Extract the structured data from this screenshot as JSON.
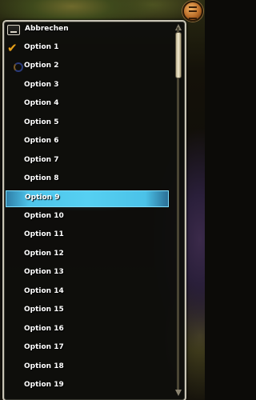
{
  "menu": {
    "cancel_label": "Abbrechen",
    "items": [
      {
        "label": "Option 1",
        "state": "checked"
      },
      {
        "label": "Option 2",
        "state": "radio"
      },
      {
        "label": "Option 3"
      },
      {
        "label": "Option 4"
      },
      {
        "label": "Option 5"
      },
      {
        "label": "Option 6"
      },
      {
        "label": "Option 7"
      },
      {
        "label": "Option 8"
      },
      {
        "label": "Option 9",
        "state": "highlighted"
      },
      {
        "label": "Option 10"
      },
      {
        "label": "Option 11"
      },
      {
        "label": "Option 12"
      },
      {
        "label": "Option 13"
      },
      {
        "label": "Option 14"
      },
      {
        "label": "Option 15"
      },
      {
        "label": "Option 16"
      },
      {
        "label": "Option 17"
      },
      {
        "label": "Option 18"
      },
      {
        "label": "Option 19"
      }
    ]
  },
  "icons": {
    "cancel": "cancel-icon",
    "check": "checkmark-icon",
    "radio": "radio-icon",
    "corner": "menu-button-icon"
  },
  "colors": {
    "highlight": "#4ec4ea",
    "check": "#e8a21a",
    "border": "#c9c5b6",
    "text": "#ffffff"
  }
}
